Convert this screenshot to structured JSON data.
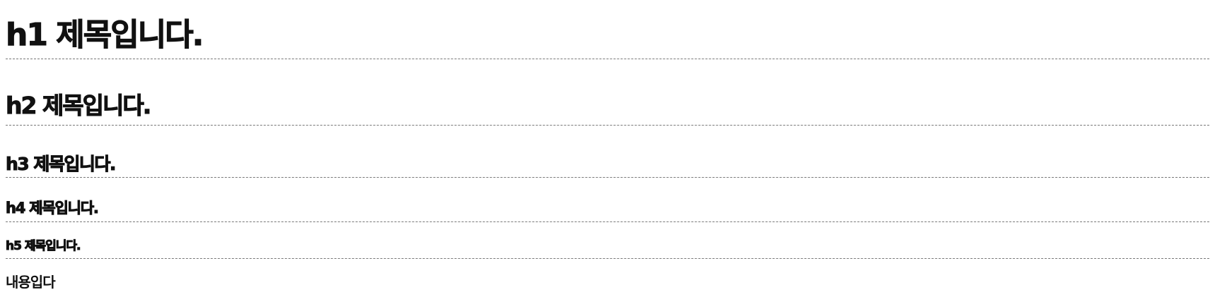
{
  "headings": {
    "h1": "h1 제목입니다.",
    "h2": "h2 제목입니다.",
    "h3": "h3 제목입니다.",
    "h4": "h4 제목입니다.",
    "h5": "h5 제목입니다."
  },
  "body": {
    "content": "내용입다"
  },
  "colors": {
    "text": "#111111",
    "divider": "#777777",
    "background": "#ffffff"
  }
}
